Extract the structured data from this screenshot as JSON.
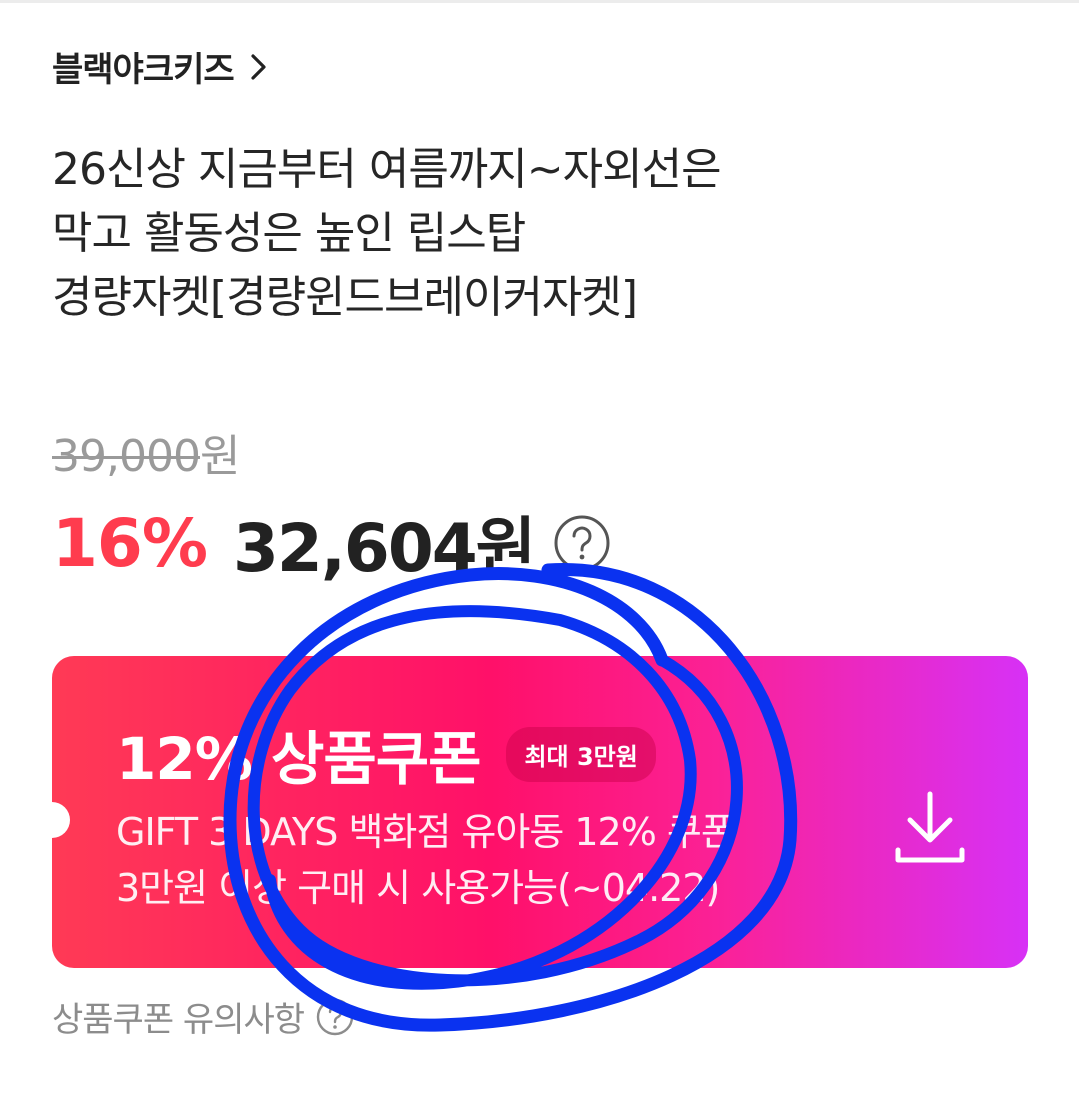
{
  "brand": {
    "name": "블랙야크키즈",
    "chevron_icon": "chevron-right-icon"
  },
  "title": {
    "lines": [
      "26신상 지금부터 여름까지~자외선은",
      "막고 활동성은 높인 립스탑",
      "경량자켓[경량윈드브레이커자켓]"
    ]
  },
  "price": {
    "original": "39,000",
    "original_unit": "원",
    "discount": "16%",
    "sale": "32,604원",
    "help_icon": "question-circle-icon"
  },
  "coupon": {
    "title": "12% 상품쿠폰",
    "badge": "최대 3만원",
    "desc_lines": [
      "GIFT 3 DAYS 백화점 유아동 12% 쿠폰",
      "3만원 이상 구매 시 사용가능(~04.22)"
    ],
    "download_icon": "download-icon",
    "colors": {
      "start": "#ff3a55",
      "mid": "#ff1069",
      "end": "#d731f6"
    }
  },
  "notice": {
    "label": "상품쿠폰 유의사항",
    "icon": "question-circle-icon"
  },
  "colors": {
    "discount": "#ff3c4e",
    "annotation": "#0a32f0"
  }
}
